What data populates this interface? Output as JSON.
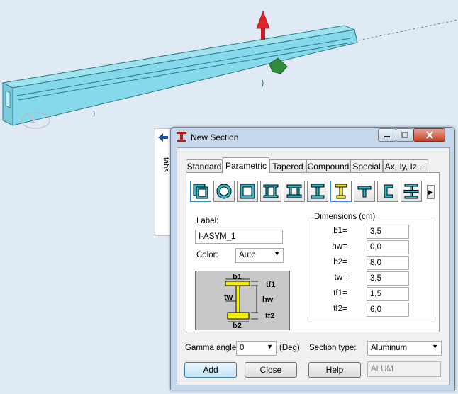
{
  "viewport": {
    "node_label": "1",
    "colors": {
      "beam": "#86d8eb",
      "beam_edge": "#2c7a8a",
      "background": "#dfeaf4",
      "load_arrow": "#e0262b",
      "marker": "#2e8b3a"
    }
  },
  "side_panel": {
    "label": "tabs",
    "arrow_icon": "left-arrow-icon"
  },
  "window": {
    "title": "New Section",
    "icon": "i-beam-icon"
  },
  "tabs": [
    {
      "label": "Standard"
    },
    {
      "label": "Parametric",
      "active": true
    },
    {
      "label": "Tapered"
    },
    {
      "label": "Compound"
    },
    {
      "label": "Special"
    },
    {
      "label": "Ax, Iy, Iz ..."
    }
  ],
  "shapes": [
    "box-section-icon",
    "pipe-section-icon",
    "square-tube-icon",
    "double-channel-icon",
    "box-girder-icon",
    "i-section-icon",
    "asymmetric-i-section-icon",
    "t-section-icon",
    "channel-section-icon",
    "cross-section-icon"
  ],
  "label_field": {
    "caption": "Label:",
    "value": "I-ASYM_1"
  },
  "color_field": {
    "caption": "Color:",
    "value": "Auto"
  },
  "dimensions": {
    "title": "Dimensions (cm)",
    "rows": [
      {
        "name": "b1",
        "value": "3,5"
      },
      {
        "name": "hw",
        "value": "0,0"
      },
      {
        "name": "b2",
        "value": "8,0"
      },
      {
        "name": "tw",
        "value": "3,5"
      },
      {
        "name": "tf1",
        "value": "1,5"
      },
      {
        "name": "tf2",
        "value": "6,0"
      }
    ]
  },
  "preview_labels": {
    "b1": "b1",
    "tf1": "tf1",
    "tw": "tw",
    "hw": "hw",
    "tf2": "tf2",
    "b2": "b2"
  },
  "gamma": {
    "caption": "Gamma angle:",
    "value": "0",
    "unit": "(Deg)"
  },
  "section_type": {
    "caption": "Section type:",
    "value": "Aluminum"
  },
  "buttons": {
    "add": "Add",
    "close": "Close",
    "help": "Help"
  },
  "material_code": "ALUM"
}
